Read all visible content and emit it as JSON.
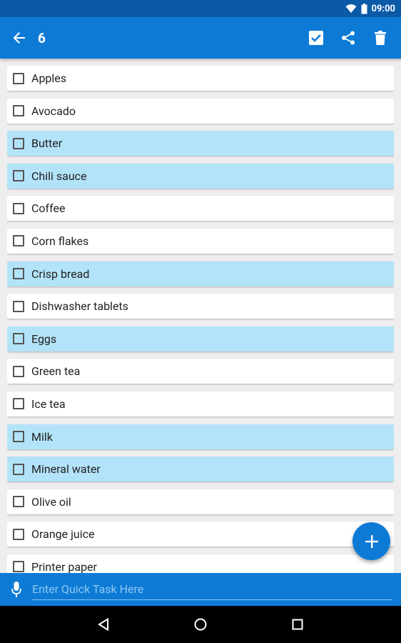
{
  "status": {
    "time": "09:00"
  },
  "header": {
    "title": "6"
  },
  "list": {
    "items": [
      {
        "label": "Apples",
        "highlighted": false
      },
      {
        "label": "Avocado",
        "highlighted": false
      },
      {
        "label": "Butter",
        "highlighted": true
      },
      {
        "label": "Chili sauce",
        "highlighted": true
      },
      {
        "label": "Coffee",
        "highlighted": false
      },
      {
        "label": "Corn flakes",
        "highlighted": false
      },
      {
        "label": "Crisp bread",
        "highlighted": true
      },
      {
        "label": "Dishwasher tablets",
        "highlighted": false
      },
      {
        "label": "Eggs",
        "highlighted": true
      },
      {
        "label": "Green tea",
        "highlighted": false
      },
      {
        "label": "Ice tea",
        "highlighted": false
      },
      {
        "label": "Milk",
        "highlighted": true
      },
      {
        "label": "Mineral water",
        "highlighted": true
      },
      {
        "label": "Olive oil",
        "highlighted": false
      },
      {
        "label": "Orange juice",
        "highlighted": false
      },
      {
        "label": "Printer paper",
        "highlighted": false
      }
    ]
  },
  "quick_task": {
    "placeholder": "Enter Quick Task Here"
  },
  "colors": {
    "primary": "#0d7bd6",
    "status_bar": "#0a5aa8",
    "highlight": "#b3e3f8"
  }
}
